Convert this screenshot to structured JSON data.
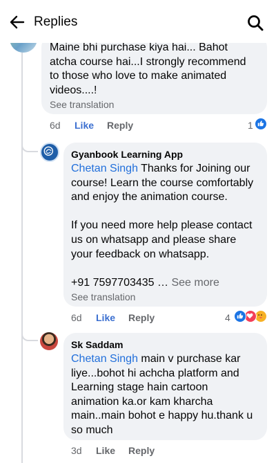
{
  "header": {
    "title": "Replies"
  },
  "replies": [
    {
      "author": "",
      "text": "Maine bhi purchase kiya hai... Bahot\natcha course hai...I strongly recommend\nto those who love to make animated\nvideos....!",
      "see_translation": "See translation",
      "time": "6d",
      "like": "Like",
      "reply": "Reply",
      "reaction_count": "1",
      "reactions": [
        "like"
      ]
    },
    {
      "author": "Gyanbook Learning App",
      "mention": "Chetan Singh",
      "text_line1": " Thanks for Joining our",
      "text_rest": "course! Learn the course comfortably\nand enjoy the animation course.\n\nIf you need more help please contact\nus on whatsapp and please share\nyour feedback on whatsapp.\n\n+91 7597703435 … ",
      "see_more": "See more",
      "see_translation": "See translation",
      "time": "6d",
      "like": "Like",
      "reply": "Reply",
      "reaction_count": "4",
      "reactions": [
        "like",
        "love",
        "care"
      ]
    },
    {
      "author": "Sk Saddam",
      "mention": "Chetan Singh",
      "text_line1": " main v purchase kar",
      "text_rest": "liye...bohot hi achcha platform and\nLearning stage hain cartoon\nanimation ka.or kam kharcha\nmain..main bohot e happy hu.thank u\nso much",
      "time": "3d",
      "like": "Like",
      "reply": "Reply"
    }
  ],
  "colors": {
    "bubble": "#f0f2f5",
    "mention": "#216fdb",
    "like_active": "#3b6fd0",
    "secondary_text": "#65676b",
    "reaction_like": "#1b74e4",
    "reaction_love": "#f33e58",
    "reaction_care": "#f7b125"
  },
  "icons": {
    "back": "arrow-left-icon",
    "search": "search-icon",
    "like_reaction": "thumbs-up-icon",
    "love_reaction": "heart-icon",
    "care_reaction": "care-emoji-icon"
  }
}
